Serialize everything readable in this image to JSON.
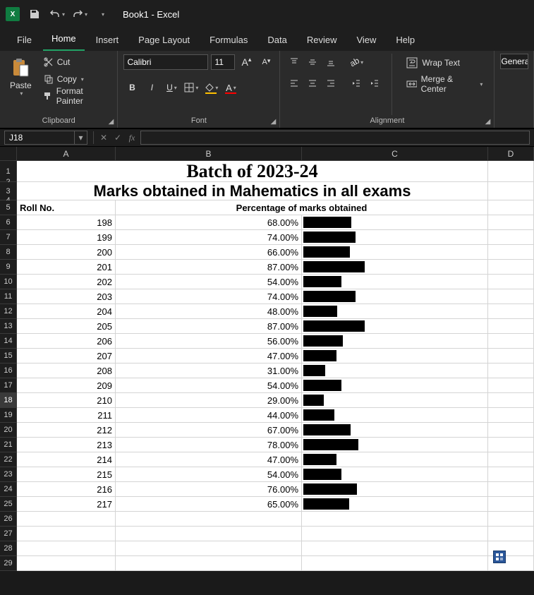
{
  "titlebar": {
    "doc_title": "Book1 - Excel"
  },
  "tabs": {
    "file": "File",
    "home": "Home",
    "insert": "Insert",
    "page_layout": "Page Layout",
    "formulas": "Formulas",
    "data": "Data",
    "review": "Review",
    "view": "View",
    "help": "Help"
  },
  "ribbon": {
    "clipboard": {
      "paste": "Paste",
      "cut": "Cut",
      "copy": "Copy",
      "format_painter": "Format Painter",
      "label": "Clipboard"
    },
    "font": {
      "name": "Calibri",
      "size": "11",
      "label": "Font"
    },
    "alignment": {
      "wrap": "Wrap Text",
      "merge": "Merge & Center",
      "label": "Alignment"
    },
    "number": {
      "format": "General"
    }
  },
  "namebox": "J18",
  "columns": [
    "A",
    "B",
    "C",
    "D"
  ],
  "sheet": {
    "title1": "Batch of 2023-24",
    "title2": "Marks obtained in Mahematics in all exams",
    "header_roll": "Roll No.",
    "header_pct": "Percentage of marks obtained",
    "rows": [
      {
        "roll": "198",
        "pct": "68.00%",
        "v": 68
      },
      {
        "roll": "199",
        "pct": "74.00%",
        "v": 74
      },
      {
        "roll": "200",
        "pct": "66.00%",
        "v": 66
      },
      {
        "roll": "201",
        "pct": "87.00%",
        "v": 87
      },
      {
        "roll": "202",
        "pct": "54.00%",
        "v": 54
      },
      {
        "roll": "203",
        "pct": "74.00%",
        "v": 74
      },
      {
        "roll": "204",
        "pct": "48.00%",
        "v": 48
      },
      {
        "roll": "205",
        "pct": "87.00%",
        "v": 87
      },
      {
        "roll": "206",
        "pct": "56.00%",
        "v": 56
      },
      {
        "roll": "207",
        "pct": "47.00%",
        "v": 47
      },
      {
        "roll": "208",
        "pct": "31.00%",
        "v": 31
      },
      {
        "roll": "209",
        "pct": "54.00%",
        "v": 54
      },
      {
        "roll": "210",
        "pct": "29.00%",
        "v": 29
      },
      {
        "roll": "211",
        "pct": "44.00%",
        "v": 44
      },
      {
        "roll": "212",
        "pct": "67.00%",
        "v": 67
      },
      {
        "roll": "213",
        "pct": "78.00%",
        "v": 78
      },
      {
        "roll": "214",
        "pct": "47.00%",
        "v": 47
      },
      {
        "roll": "215",
        "pct": "54.00%",
        "v": 54
      },
      {
        "roll": "216",
        "pct": "76.00%",
        "v": 76
      },
      {
        "roll": "217",
        "pct": "65.00%",
        "v": 65
      }
    ]
  },
  "chart_data": {
    "type": "bar",
    "title": "Marks obtained in Mahematics in all exams",
    "categories": [
      "198",
      "199",
      "200",
      "201",
      "202",
      "203",
      "204",
      "205",
      "206",
      "207",
      "208",
      "209",
      "210",
      "211",
      "212",
      "213",
      "214",
      "215",
      "216",
      "217"
    ],
    "values": [
      68,
      74,
      66,
      87,
      54,
      74,
      48,
      87,
      56,
      47,
      31,
      54,
      29,
      44,
      67,
      78,
      47,
      54,
      76,
      65
    ],
    "xlabel": "Roll No.",
    "ylabel": "Percentage of marks obtained",
    "ylim": [
      0,
      100
    ]
  }
}
